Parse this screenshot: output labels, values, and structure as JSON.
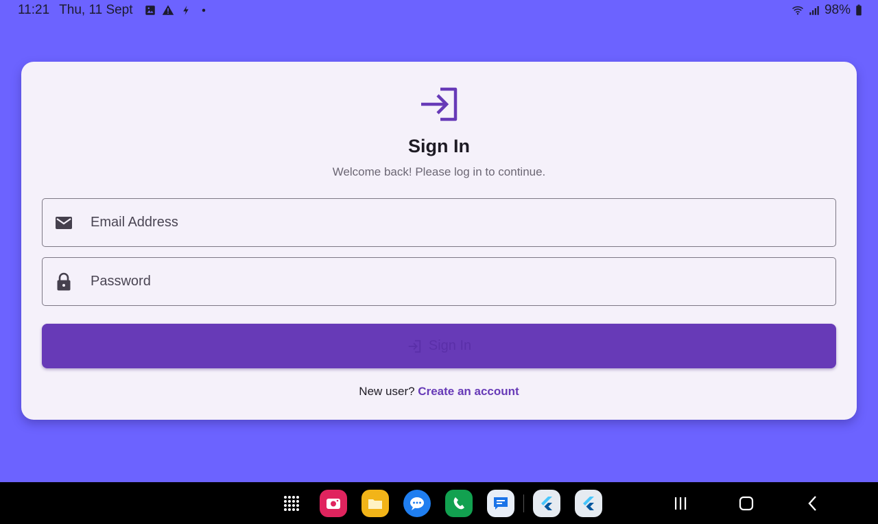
{
  "status_bar": {
    "time": "11:21",
    "date": "Thu, 11 Sept",
    "left_icons": [
      "gallery-icon",
      "warning-icon",
      "flash-icon",
      "dot-icon"
    ],
    "right_icons": [
      "wifi-icon",
      "signal-icon",
      "battery-icon"
    ],
    "battery": "98%"
  },
  "card": {
    "icon": "login-icon",
    "title": "Sign In",
    "subtitle": "Welcome back! Please log in to continue.",
    "email": {
      "placeholder": "Email Address",
      "value": "",
      "icon": "mail-icon"
    },
    "password": {
      "placeholder": "Password",
      "value": "",
      "icon": "lock-icon"
    },
    "submit": {
      "label": "Sign In",
      "icon": "login-icon",
      "enabled": false
    },
    "footer": {
      "prompt": "New user?",
      "link": "Create an account"
    }
  },
  "colors": {
    "background": "#6c63ff",
    "card": "#f5f1fa",
    "primary": "#673ab7",
    "text": "#1e1b24",
    "muted": "#6b6673"
  },
  "nav_bar": {
    "dock_apps": [
      "app-grid-icon",
      "screen-recorder-app-icon",
      "files-app-icon",
      "messages-app-icon",
      "phone-app-icon",
      "google-messages-app-icon",
      "flutter-app-icon",
      "flutter-app-icon"
    ],
    "system_buttons": [
      "recents-button",
      "home-button",
      "back-button"
    ]
  }
}
